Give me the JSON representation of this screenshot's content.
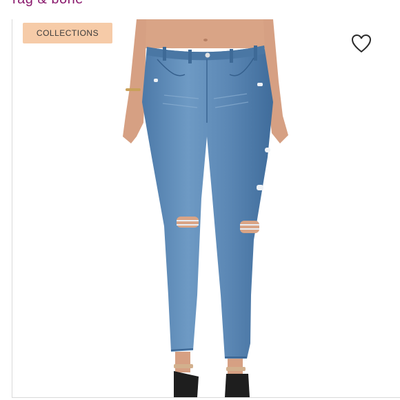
{
  "header": {
    "brand": "rag & bone"
  },
  "listing": {
    "badge": "COLLECTIONS",
    "like_icon": "heart-outline-icon",
    "colors": {
      "badge_bg": "#f6cba8",
      "brand_text": "#8a1a6d",
      "denim": "#5b88b6"
    }
  }
}
